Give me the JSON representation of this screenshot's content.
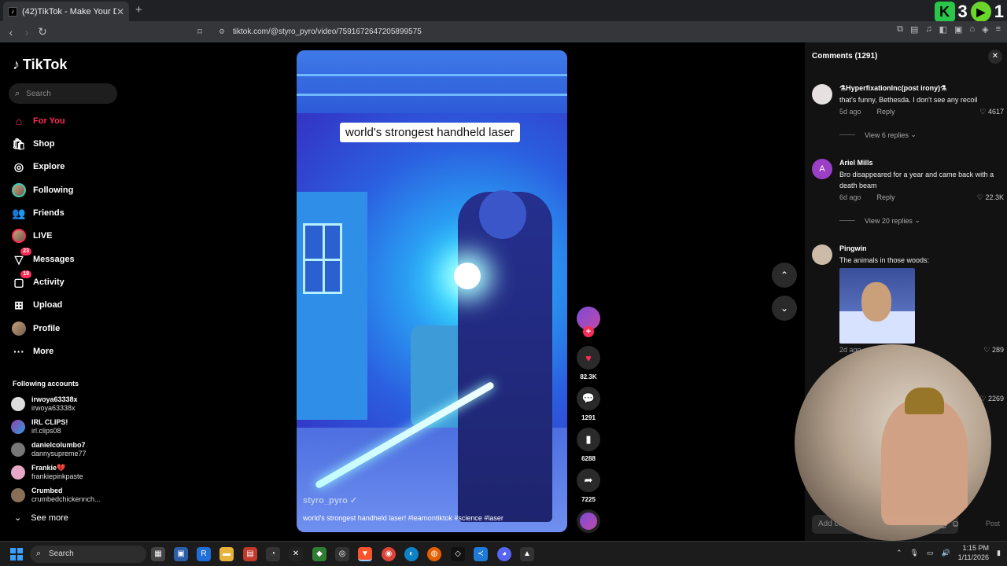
{
  "browser": {
    "tab_title": "(42)TikTok - Make Your Day",
    "tab_close": "✕",
    "new_tab": "+",
    "url": "tiktok.com/@styro_pyro/video/7591672647205899575",
    "overlay_count_1": "3",
    "overlay_count_2": "1"
  },
  "sidebar": {
    "logo": "TikTok",
    "search_placeholder": "Search",
    "nav": [
      {
        "label": "For You",
        "icon": "home-icon"
      },
      {
        "label": "Shop",
        "icon": "shop-icon"
      },
      {
        "label": "Explore",
        "icon": "compass-icon"
      },
      {
        "label": "Following",
        "icon": "following-avatar-icon"
      },
      {
        "label": "Friends",
        "icon": "friends-icon"
      },
      {
        "label": "LIVE",
        "icon": "live-icon"
      },
      {
        "label": "Messages",
        "icon": "messages-icon",
        "badge": "23"
      },
      {
        "label": "Activity",
        "icon": "activity-icon",
        "badge": "19"
      },
      {
        "label": "Upload",
        "icon": "upload-icon"
      },
      {
        "label": "Profile",
        "icon": "profile-avatar-icon"
      },
      {
        "label": "More",
        "icon": "more-icon"
      }
    ],
    "following_title": "Following accounts",
    "accounts": [
      {
        "name": "irwoya63338x",
        "username": "irwoya63338x"
      },
      {
        "name": "IRL CLIPS!",
        "username": "irl.clips08"
      },
      {
        "name": "danielcolumbo7",
        "username": "dannysupreme77"
      },
      {
        "name": "Frankie💔",
        "username": "frankiepinkpaste"
      },
      {
        "name": "Crumbed",
        "username": "crumbedchickennch..."
      }
    ],
    "see_more": "See more"
  },
  "video": {
    "caption": "world's strongest handheld laser",
    "author": "styro_pyro ✓",
    "description": "world's strongest handheld laser! #learnontiktok #science #laser",
    "likes": "82.3K",
    "comments": "1291",
    "saves": "6288",
    "shares": "7225"
  },
  "comments": {
    "header": "Comments (1291)",
    "items": [
      {
        "name": "⚗HyperfixationInc(post irony)⚗",
        "text": "that's funny, Bethesda. I don't see any recoil",
        "time": "5d ago",
        "reply": "Reply",
        "likes": "4617",
        "view_replies": "View 6 replies"
      },
      {
        "name": "Ariel Mills",
        "initial": "A",
        "text": "Bro disappeared for a year and came back with a death beam",
        "time": "6d ago",
        "reply": "Reply",
        "likes": "22.3K",
        "view_replies": "View 20 replies"
      },
      {
        "name": "Pingwin",
        "text": "The animals in those woods:",
        "time": "2d ago",
        "likes": "289"
      },
      {
        "likes": "2269"
      }
    ],
    "add_placeholder": "Add comment...",
    "post": "Post"
  },
  "taskbar": {
    "search": "Search",
    "time": "1:15 PM",
    "date": "1/11/2026"
  },
  "colors": {
    "accent": "#fe2c55",
    "panel": "#121212"
  }
}
